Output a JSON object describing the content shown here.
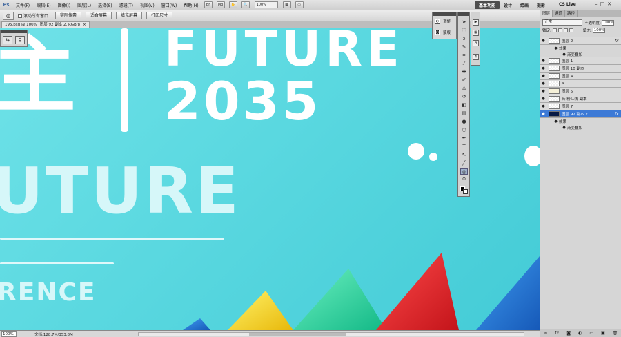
{
  "app": {
    "logo": "Ps"
  },
  "menu": [
    "文件(F)",
    "编辑(E)",
    "图像(I)",
    "图层(L)",
    "选择(S)",
    "滤镜(T)",
    "视图(V)",
    "窗口(W)",
    "帮助(H)"
  ],
  "menubar_zoom": "100%",
  "workspace": {
    "items": [
      "基本功能",
      "设计",
      "绘画",
      "摄影"
    ],
    "active": "基本功能"
  },
  "cslive": "CS Live",
  "options": {
    "checkbox_label": "滚动所有窗口",
    "buttons": [
      "实际像素",
      "适合屏幕",
      "填充屏幕",
      "打印尺寸"
    ]
  },
  "document": {
    "tab_title": "195.psd @ 100% (图层 92 副本 2, RGB/8)"
  },
  "canvas": {
    "char_big": "主",
    "text_future": "FUTURE",
    "text_year": "2035",
    "text_uture": "UTURE",
    "text_ence": "RENCE",
    "colors": {
      "bg_start": "#6fe2e8",
      "bg_end": "#43cbd6",
      "yellow": "#f7d51d",
      "green": "#22d39a",
      "red": "#e0262a",
      "blue": "#1e78d2"
    }
  },
  "adjust_panel": {
    "items": [
      "调整",
      "蒙版"
    ]
  },
  "layers_panel": {
    "tabs": [
      "图层",
      "通道",
      "路径"
    ],
    "blend_mode": "正常",
    "opacity_label": "不透明度:",
    "opacity": "100%",
    "lock_label": "锁定:",
    "fill_label": "填充:",
    "fill": "100%",
    "layers": [
      {
        "name": "图层 2",
        "fx": "fx",
        "thumb": "checker",
        "selected": false
      },
      {
        "sub": "效果",
        "indent": false
      },
      {
        "sub": "渐变叠加",
        "indent": true
      },
      {
        "name": "图层 1",
        "fx": "",
        "thumb": "checker",
        "selected": false
      },
      {
        "name": "图层 10 副本",
        "fx": "",
        "thumb": "checker",
        "selected": false
      },
      {
        "name": "图层 4",
        "fx": "",
        "thumb": "checker",
        "selected": false
      },
      {
        "name": "a",
        "fx": "",
        "thumb": "checker",
        "selected": false
      },
      {
        "name": "图层 5",
        "fx": "",
        "thumb": "icon",
        "selected": false
      },
      {
        "name": "头 粉红线 副本",
        "fx": "",
        "thumb": "checker",
        "selected": false
      },
      {
        "name": "图层 7",
        "fx": "",
        "thumb": "checker",
        "selected": false
      },
      {
        "name": "图层 92 副本 2",
        "fx": "fx",
        "thumb": "dark",
        "selected": true
      },
      {
        "sub": "效果",
        "indent": false
      },
      {
        "sub": "渐变叠加",
        "indent": true
      }
    ]
  },
  "status": {
    "zoom": "100%",
    "doc_size": "文档:128.7M/353.8M"
  }
}
